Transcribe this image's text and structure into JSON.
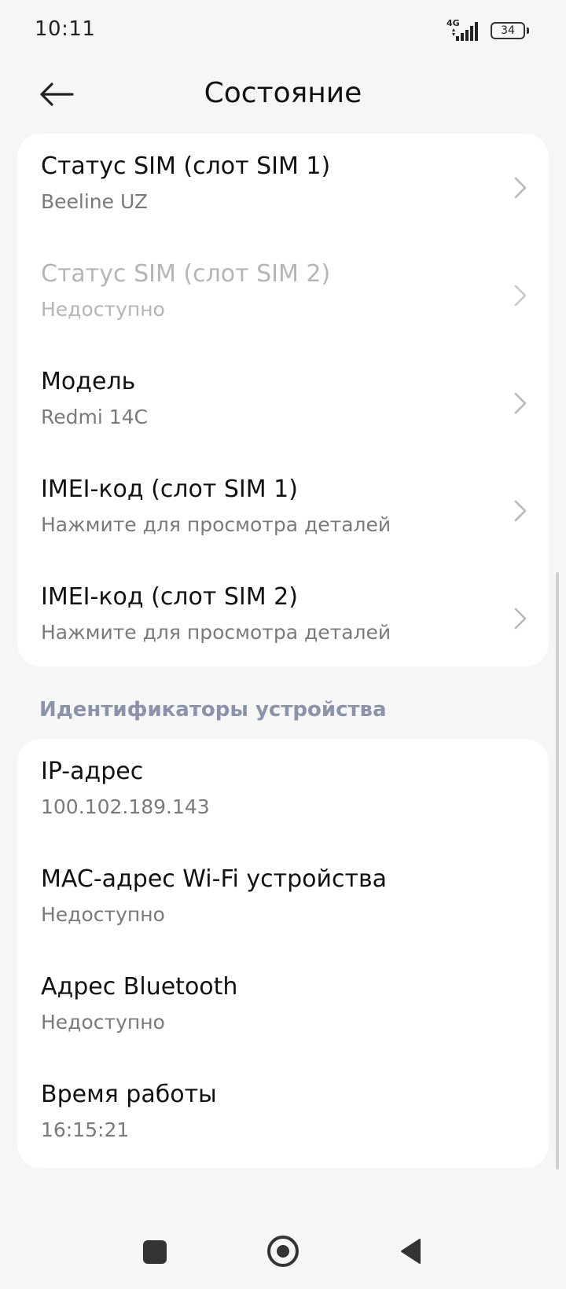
{
  "status_bar": {
    "time": "10:11",
    "network": "4G",
    "battery": "34"
  },
  "header": {
    "title": "Состояние",
    "back_icon": "arrow-left-icon"
  },
  "sim_card": {
    "items": [
      {
        "title": "Статус SIM (слот SIM 1)",
        "subtitle": "Beeline UZ",
        "enabled": true
      },
      {
        "title": "Статус SIM (слот SIM 2)",
        "subtitle": "Недоступно",
        "enabled": false
      },
      {
        "title": "Модель",
        "subtitle": "Redmi 14C",
        "enabled": true
      },
      {
        "title": "IMEI-код (слот SIM 1)",
        "subtitle": "Нажмите для просмотра деталей",
        "enabled": true
      },
      {
        "title": "IMEI-код (слот SIM 2)",
        "subtitle": "Нажмите для просмотра деталей",
        "enabled": true
      }
    ]
  },
  "identifiers": {
    "section_title": "Идентификаторы устройства",
    "items": [
      {
        "title": "IP-адрес",
        "subtitle": "100.102.189.143"
      },
      {
        "title": "MAC-адрес Wi-Fi устройства",
        "subtitle": "Недоступно"
      },
      {
        "title": "Адрес Bluetooth",
        "subtitle": "Недоступно"
      },
      {
        "title": "Время работы",
        "subtitle": "16:15:21"
      }
    ]
  },
  "colors": {
    "background": "#f6f6f6",
    "card": "#ffffff",
    "section_header": "#8a93a8",
    "secondary_text": "#7a7a7a",
    "disabled_text": "#b5b5b5"
  },
  "nav_bar": {
    "icons": [
      "recents-icon",
      "home-icon",
      "back-icon"
    ]
  }
}
